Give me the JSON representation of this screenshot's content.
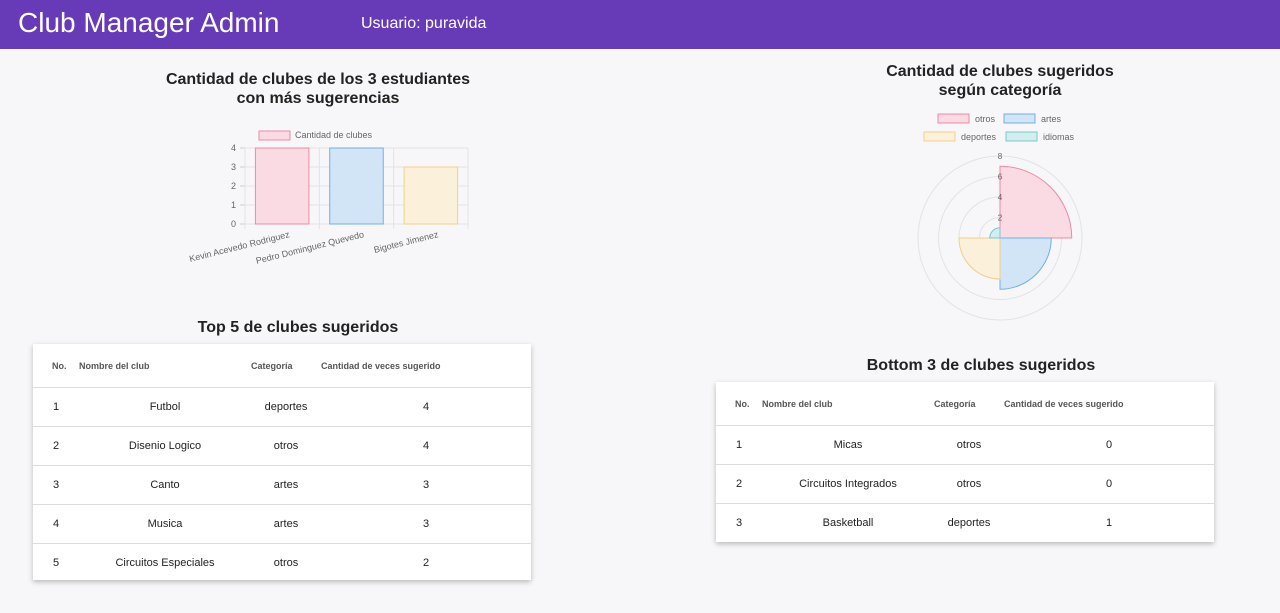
{
  "header": {
    "title": "Club Manager Admin",
    "user": "Usuario: puravida"
  },
  "bar_section": {
    "title_line1": "Cantidad de clubes de los 3 estudiantes",
    "title_line2": "con más sugerencias"
  },
  "polar_section": {
    "title_line1": "Cantidad de clubes sugeridos",
    "title_line2": "según categoría"
  },
  "top_section": {
    "title": "Top 5 de clubes sugeridos",
    "columns": [
      "No.",
      "Nombre del club",
      "Categoría",
      "Cantidad de veces sugerido"
    ],
    "rows": [
      [
        "1",
        "Futbol",
        "deportes",
        "4"
      ],
      [
        "2",
        "Disenio Logico",
        "otros",
        "4"
      ],
      [
        "3",
        "Canto",
        "artes",
        "3"
      ],
      [
        "4",
        "Musica",
        "artes",
        "3"
      ],
      [
        "5",
        "Circuitos Especiales",
        "otros",
        "2"
      ]
    ]
  },
  "bottom_section": {
    "title": "Bottom 3 de clubes sugeridos",
    "columns": [
      "No.",
      "Nombre del club",
      "Categoría",
      "Cantidad de veces sugerido"
    ],
    "rows": [
      [
        "1",
        "Micas",
        "otros",
        "0"
      ],
      [
        "2",
        "Circuitos Integrados",
        "otros",
        "0"
      ],
      [
        "3",
        "Basketball",
        "deportes",
        "1"
      ]
    ]
  },
  "chart_data": [
    {
      "type": "bar",
      "categories": [
        "Kevin Acevedo Rodriguez",
        "Pedro Dominguez Quevedo",
        "Bigotes Jimenez"
      ],
      "series": [
        {
          "name": "Cantidad de clubes",
          "values": [
            4,
            4,
            3
          ]
        }
      ],
      "ylim": [
        0,
        4
      ],
      "yticks": [
        "0",
        "1",
        "2",
        "3",
        "4"
      ],
      "colors": {
        "fill": [
          "#fadbe3",
          "#d2e5f6",
          "#fbf0d9"
        ],
        "stroke": [
          "#ef8aa4",
          "#6fb0e6",
          "#f4cf87"
        ]
      },
      "grid": true,
      "legend_position": "top"
    },
    {
      "type": "polar-area",
      "categories": [
        "otros",
        "artes",
        "deportes",
        "idiomas"
      ],
      "values": [
        7,
        5,
        4,
        1
      ],
      "rmax": 8,
      "ticks": [
        "2",
        "4",
        "6",
        "8"
      ],
      "colors": {
        "fill": [
          "#fadbe3",
          "#d2e5f6",
          "#fbf0d9",
          "#d4eef0"
        ],
        "stroke": [
          "#ef8aa4",
          "#6fb0e6",
          "#f4cf87",
          "#79c8cc"
        ]
      },
      "grid": true,
      "legend_position": "top"
    }
  ]
}
